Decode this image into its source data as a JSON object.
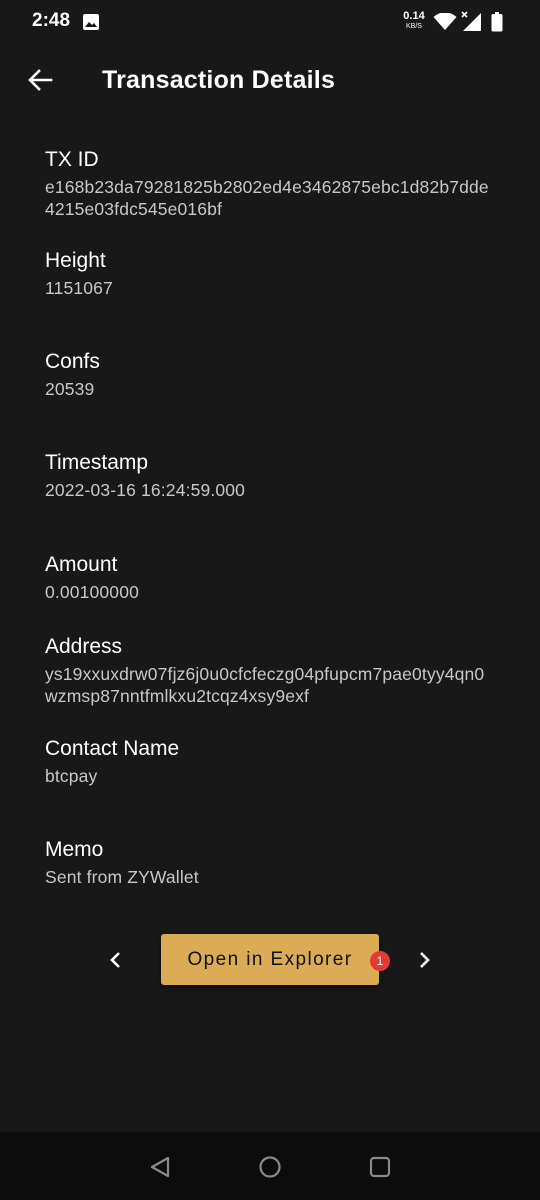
{
  "status_bar": {
    "time": "2:48",
    "net_speed_value": "0.14",
    "net_speed_unit": "KB/S",
    "icons": [
      "image-icon",
      "wifi-icon",
      "signal-icon",
      "battery-icon"
    ]
  },
  "app_bar": {
    "title": "Transaction Details",
    "back_icon": "arrow-left-icon"
  },
  "details": {
    "txid": {
      "label": "TX ID",
      "value": "e168b23da79281825b2802ed4e3462875ebc1d82b7dde4215e03fdc545e016bf"
    },
    "height": {
      "label": "Height",
      "value": "1151067"
    },
    "confs": {
      "label": "Confs",
      "value": "20539"
    },
    "timestamp": {
      "label": "Timestamp",
      "value": "2022-03-16 16:24:59.000"
    },
    "amount": {
      "label": "Amount",
      "value": "0.00100000"
    },
    "address": {
      "label": "Address",
      "value": "ys19xxuxdrw07fjz6j0u0cfcfeczg04pfupcm7pae0tyy4qn0wzmsp87nntfmlkxu2tcqz4xsy9exf"
    },
    "contact": {
      "label": "Contact Name",
      "value": "btcpay"
    },
    "memo": {
      "label": "Memo",
      "value": "Sent from ZYWallet"
    }
  },
  "actions": {
    "explorer_label": "Open in Explorer",
    "badge_count": "1",
    "prev_icon": "chevron-left-icon",
    "next_icon": "chevron-right-icon"
  },
  "colors": {
    "background": "#181818",
    "accent": "#dcab55",
    "badge": "#e53935",
    "value_text": "#c8c8c8"
  }
}
